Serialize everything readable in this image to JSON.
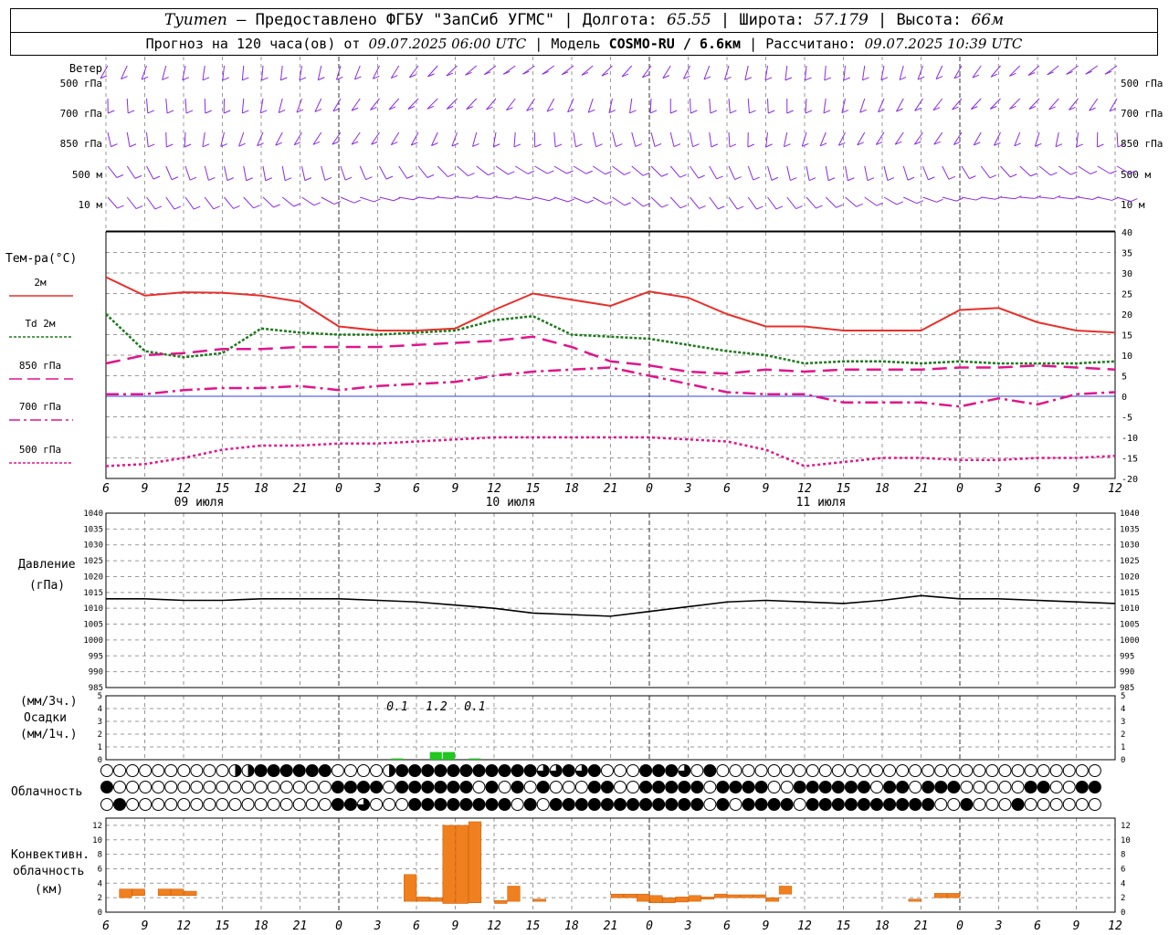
{
  "header": {
    "city": "Tyumen",
    "dash": "–",
    "provider": "Предоставлено ФГБУ \"ЗапСиб УГМС\"",
    "lon_label": "Долгота:",
    "lon": "65.55",
    "lat_label": "Широта:",
    "lat": "57.179",
    "alt_label": "Высота:",
    "alt": "66м",
    "forecast_label": "Прогноз на 120 часа(ов) от",
    "forecast_time": "09.07.2025 06:00 UTC",
    "model_label": "Модель",
    "model_name": "COSMO-RU / 6.6км",
    "calc_label": "Рассчитано:",
    "calc_time": "09.07.2025 10:39 UTC"
  },
  "wind_panel": {
    "title": "Ветер",
    "levels": [
      "500 гПа",
      "700 гПа",
      "850 гПа",
      "500 м",
      "10  м"
    ],
    "barb_color": "#8a2be2"
  },
  "time_axis": {
    "hour_labels": [
      "6",
      "9",
      "12",
      "15",
      "18",
      "21",
      "0",
      "3",
      "6",
      "9",
      "12",
      "15",
      "18",
      "21",
      "0",
      "3",
      "6",
      "9",
      "12",
      "15",
      "18",
      "21",
      "0",
      "3",
      "6",
      "9",
      "12"
    ],
    "date_labels": [
      "09 июля",
      "10 июля",
      "11 июля"
    ]
  },
  "temp_panel": {
    "title": "Тем-ра(°C)",
    "legend": [
      {
        "label": "2м",
        "color": "#e8302a",
        "style": "solid"
      },
      {
        "label": "Td  2м",
        "color": "#1a7a1a",
        "style": "dotted"
      },
      {
        "label": "850 гПа",
        "color": "#e0158a",
        "style": "dashed"
      },
      {
        "label": "700 гПа",
        "color": "#e0158a",
        "style": "dashdot"
      },
      {
        "label": "500 гПа",
        "color": "#e0158a",
        "style": "dotted"
      }
    ],
    "y_ticks": [
      "40",
      "35",
      "30",
      "25",
      "20",
      "15",
      "10",
      "5",
      "0",
      "-5",
      "-10",
      "-15",
      "-20"
    ]
  },
  "pressure_panel": {
    "title": "Давление",
    "unit": "(гПа)",
    "y_ticks": [
      "1040",
      "1035",
      "1030",
      "1025",
      "1020",
      "1015",
      "1010",
      "1005",
      "1000",
      "995",
      "990",
      "985"
    ]
  },
  "precip_panel": {
    "unit_top": "(мм/3ч.)",
    "title": "Осадки",
    "unit_bottom": "(мм/1ч.)",
    "y_ticks": [
      "5",
      "4",
      "3",
      "2",
      "1",
      "0"
    ],
    "labels": [
      "0.1",
      "1.2",
      "0.1"
    ]
  },
  "cloud_panel": {
    "title": "Облачность"
  },
  "conv_panel": {
    "title1": "Конвективн.",
    "title2": "облачность",
    "unit": "(км)",
    "y_ticks": [
      "12",
      "10",
      "8",
      "6",
      "4",
      "2",
      "0"
    ]
  },
  "chart_data": [
    {
      "type": "line",
      "title": "Тем-ра(°C)",
      "ylim": [
        -20,
        40
      ],
      "x_hours": [
        0,
        3,
        6,
        9,
        12,
        15,
        18,
        21,
        24,
        27,
        30,
        33,
        36,
        39,
        42,
        45,
        48,
        51,
        54,
        57,
        60,
        63,
        66,
        69,
        72,
        75,
        78
      ],
      "series": [
        {
          "name": "2м",
          "values": [
            29,
            24.5,
            25.3,
            25.2,
            24.5,
            23,
            17,
            16,
            16,
            16.5,
            21,
            25,
            23.5,
            22,
            25.5,
            24,
            20,
            17,
            17,
            16,
            16,
            16,
            21,
            21.5,
            18,
            16,
            15.5
          ]
        },
        {
          "name": "Td  2м",
          "values": [
            20,
            11,
            9.5,
            10.5,
            16.5,
            15.5,
            15,
            15,
            15.5,
            16,
            18.5,
            19.5,
            15,
            14.5,
            14,
            12.5,
            11,
            10,
            8,
            8.5,
            8.5,
            8,
            8.5,
            8,
            8,
            8,
            8.5
          ]
        },
        {
          "name": "850 гПа",
          "values": [
            8,
            10,
            10.5,
            11.5,
            11.5,
            12,
            12,
            12,
            12.5,
            13,
            13.5,
            14.5,
            12,
            8.5,
            7.5,
            6,
            5.5,
            6.5,
            6,
            6.5,
            6.5,
            6.5,
            7,
            7,
            7.5,
            7,
            6.5
          ]
        },
        {
          "name": "700 гПа",
          "values": [
            0.5,
            0.5,
            1.5,
            2,
            2,
            2.5,
            1.5,
            2.5,
            3,
            3.5,
            5,
            6,
            6.5,
            7,
            5,
            3,
            1,
            0.5,
            0.5,
            -1.5,
            -1.5,
            -1.5,
            -2.5,
            -0.5,
            -2,
            0.5,
            1
          ]
        },
        {
          "name": "500 гПа",
          "values": [
            -17,
            -16.5,
            -15,
            -13,
            -12,
            -12,
            -11.5,
            -11.5,
            -11,
            -10.5,
            -10,
            -10,
            -10,
            -10,
            -10,
            -10.5,
            -11,
            -13,
            -17,
            -16,
            -15,
            -15,
            -15.5,
            -15.5,
            -15,
            -15,
            -14.5
          ]
        }
      ]
    },
    {
      "type": "line",
      "title": "Давление",
      "ylim": [
        985,
        1040
      ],
      "x_hours": [
        0,
        3,
        6,
        9,
        12,
        15,
        18,
        21,
        24,
        27,
        30,
        33,
        36,
        39,
        42,
        45,
        48,
        51,
        54,
        57,
        60,
        63,
        66,
        69,
        72,
        75,
        78
      ],
      "series": [
        {
          "name": "Давление",
          "values": [
            1013,
            1013,
            1012.5,
            1012.5,
            1013,
            1013,
            1013,
            1012.5,
            1012,
            1011,
            1010,
            1008.5,
            1008,
            1007.5,
            1009,
            1010.5,
            1012,
            1012.5,
            1012,
            1011.5,
            1012.5,
            1014,
            1013,
            1013,
            1012.5,
            1012,
            1011.5
          ]
        }
      ]
    },
    {
      "type": "bar",
      "title": "Осадки",
      "ylim": [
        0,
        5
      ],
      "bars": [
        {
          "hour": 22,
          "value": 0.1
        },
        {
          "hour": 25,
          "value": 0.6
        },
        {
          "hour": 26,
          "value": 0.6
        },
        {
          "hour": 28,
          "value": 0.1
        }
      ]
    },
    {
      "type": "bar",
      "title": "Конвективн. облачность",
      "ylim": [
        0,
        13
      ],
      "bars": [
        {
          "hour": 1,
          "bottom": 2,
          "top": 3.2
        },
        {
          "hour": 2,
          "bottom": 2.3,
          "top": 3.2
        },
        {
          "hour": 4,
          "bottom": 2.3,
          "top": 3.2
        },
        {
          "hour": 5,
          "bottom": 2.3,
          "top": 3.2
        },
        {
          "hour": 6,
          "bottom": 2.3,
          "top": 2.9
        },
        {
          "hour": 23,
          "bottom": 1.5,
          "top": 5.2
        },
        {
          "hour": 24,
          "bottom": 1.5,
          "top": 2.1
        },
        {
          "hour": 25,
          "bottom": 1.5,
          "top": 2.0
        },
        {
          "hour": 26,
          "bottom": 1.2,
          "top": 12
        },
        {
          "hour": 27,
          "bottom": 1.2,
          "top": 12
        },
        {
          "hour": 28,
          "bottom": 1.3,
          "top": 12.5
        },
        {
          "hour": 30,
          "bottom": 1.2,
          "top": 1.6
        },
        {
          "hour": 31,
          "bottom": 1.5,
          "top": 3.6
        },
        {
          "hour": 33,
          "bottom": 1.5,
          "top": 1.8
        },
        {
          "hour": 39,
          "bottom": 2.0,
          "top": 2.5
        },
        {
          "hour": 40,
          "bottom": 2.0,
          "top": 2.5
        },
        {
          "hour": 41,
          "bottom": 1.5,
          "top": 2.5
        },
        {
          "hour": 42,
          "bottom": 1.3,
          "top": 2.3
        },
        {
          "hour": 43,
          "bottom": 1.3,
          "top": 2.0
        },
        {
          "hour": 44,
          "bottom": 1.4,
          "top": 2.1
        },
        {
          "hour": 45,
          "bottom": 1.5,
          "top": 2.3
        },
        {
          "hour": 46,
          "bottom": 1.8,
          "top": 2.1
        },
        {
          "hour": 47,
          "bottom": 2.0,
          "top": 2.5
        },
        {
          "hour": 48,
          "bottom": 2.0,
          "top": 2.4
        },
        {
          "hour": 49,
          "bottom": 2.0,
          "top": 2.4
        },
        {
          "hour": 50,
          "bottom": 2.0,
          "top": 2.4
        },
        {
          "hour": 51,
          "bottom": 1.5,
          "top": 2.0
        },
        {
          "hour": 52,
          "bottom": 2.5,
          "top": 3.6
        },
        {
          "hour": 62,
          "bottom": 1.5,
          "top": 1.8
        },
        {
          "hour": 64,
          "bottom": 2.0,
          "top": 2.6
        },
        {
          "hour": 65,
          "bottom": 2.0,
          "top": 2.6
        }
      ]
    }
  ],
  "cloud_rows": [
    "000000000011222222000012222222222233232000222302000000000000000000000000000000",
    "200000000000000000222202222220202020002200222220222200222222022022200000220022",
    "020000000000000000223000222222220202222222222220202222022222222220020002000000"
  ]
}
